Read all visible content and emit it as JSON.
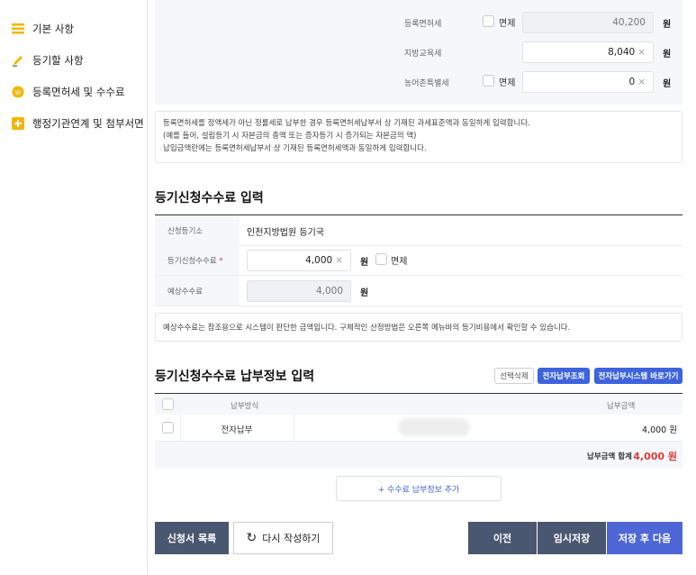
{
  "sidebar": {
    "items": [
      {
        "label": "기본 사항",
        "icon": "list-icon",
        "color": "#f2b705"
      },
      {
        "label": "등기할 사항",
        "icon": "pencil-icon",
        "color": "#f2b705"
      },
      {
        "label": "등록면허세 및 수수료",
        "icon": "coin-icon",
        "color": "#f2b705"
      },
      {
        "label": "행정기관연계 및 첨부서면",
        "icon": "plus-icon",
        "color": "#f2b705"
      }
    ]
  },
  "tax": {
    "rows": [
      {
        "label": "등록면허세",
        "exempt_label": "면제",
        "value": "40,200",
        "unit": "원",
        "disabled": true
      },
      {
        "label": "지방교육세",
        "value": "8,040",
        "unit": "원",
        "disabled": false
      },
      {
        "label": "농어촌특별세",
        "exempt_label": "면제",
        "value": "0",
        "unit": "원",
        "disabled": false
      }
    ],
    "clear_glyph": "×",
    "note": [
      "등록면허세를 정액세가 아닌 정률세로 납부한 경우 등록면허세납부서 상 기재된 과세표준액과 동일하게 입력합니다.",
      "(예를 들어, 설립등기 시 자본금의 총액 또는 증자등기 시 증가되는 자본금의 액)",
      "납입금액란에는 등록면허세납부서 상 기재된 등록면허세액과 동일하게 입력합니다."
    ]
  },
  "fee": {
    "title": "등기신청수수료 입력",
    "registry_label": "신청등기소",
    "registry_value": "인천지방법원 등기국",
    "fee_label": "등기신청수수료",
    "required_mark": "*",
    "fee_value": "4,000",
    "unit": "원",
    "exempt_label": "면제",
    "expected_label": "예상수수료",
    "expected_value": "4,000",
    "note": "예상수수료는 참조용으로 시스템이 판단한 금액입니다. 구체적인 산정방법은 오른쪽 메뉴바의 등기비용에서 확인할 수 있습니다."
  },
  "payment": {
    "title": "등기신청수수료 납부정보 입력",
    "btn_delete": "선택삭제",
    "btn_lookup": "전자납부조회",
    "btn_system": "전자납부시스템 바로가기",
    "col_method": "납부방식",
    "col_amount": "납부금액",
    "rows": [
      {
        "method": "전자납부",
        "amount": "4,000 원"
      }
    ],
    "total_label": "납부금액 합계",
    "total_value": "4,000 원",
    "add_button": "+ 수수료 납부정보 추가"
  },
  "footer": {
    "list_button": "신청서 목록",
    "rewrite_button": "다시 작성하기",
    "prev_button": "이전",
    "temp_save_button": "임시저장",
    "save_next_button": "저장 후 다음"
  }
}
